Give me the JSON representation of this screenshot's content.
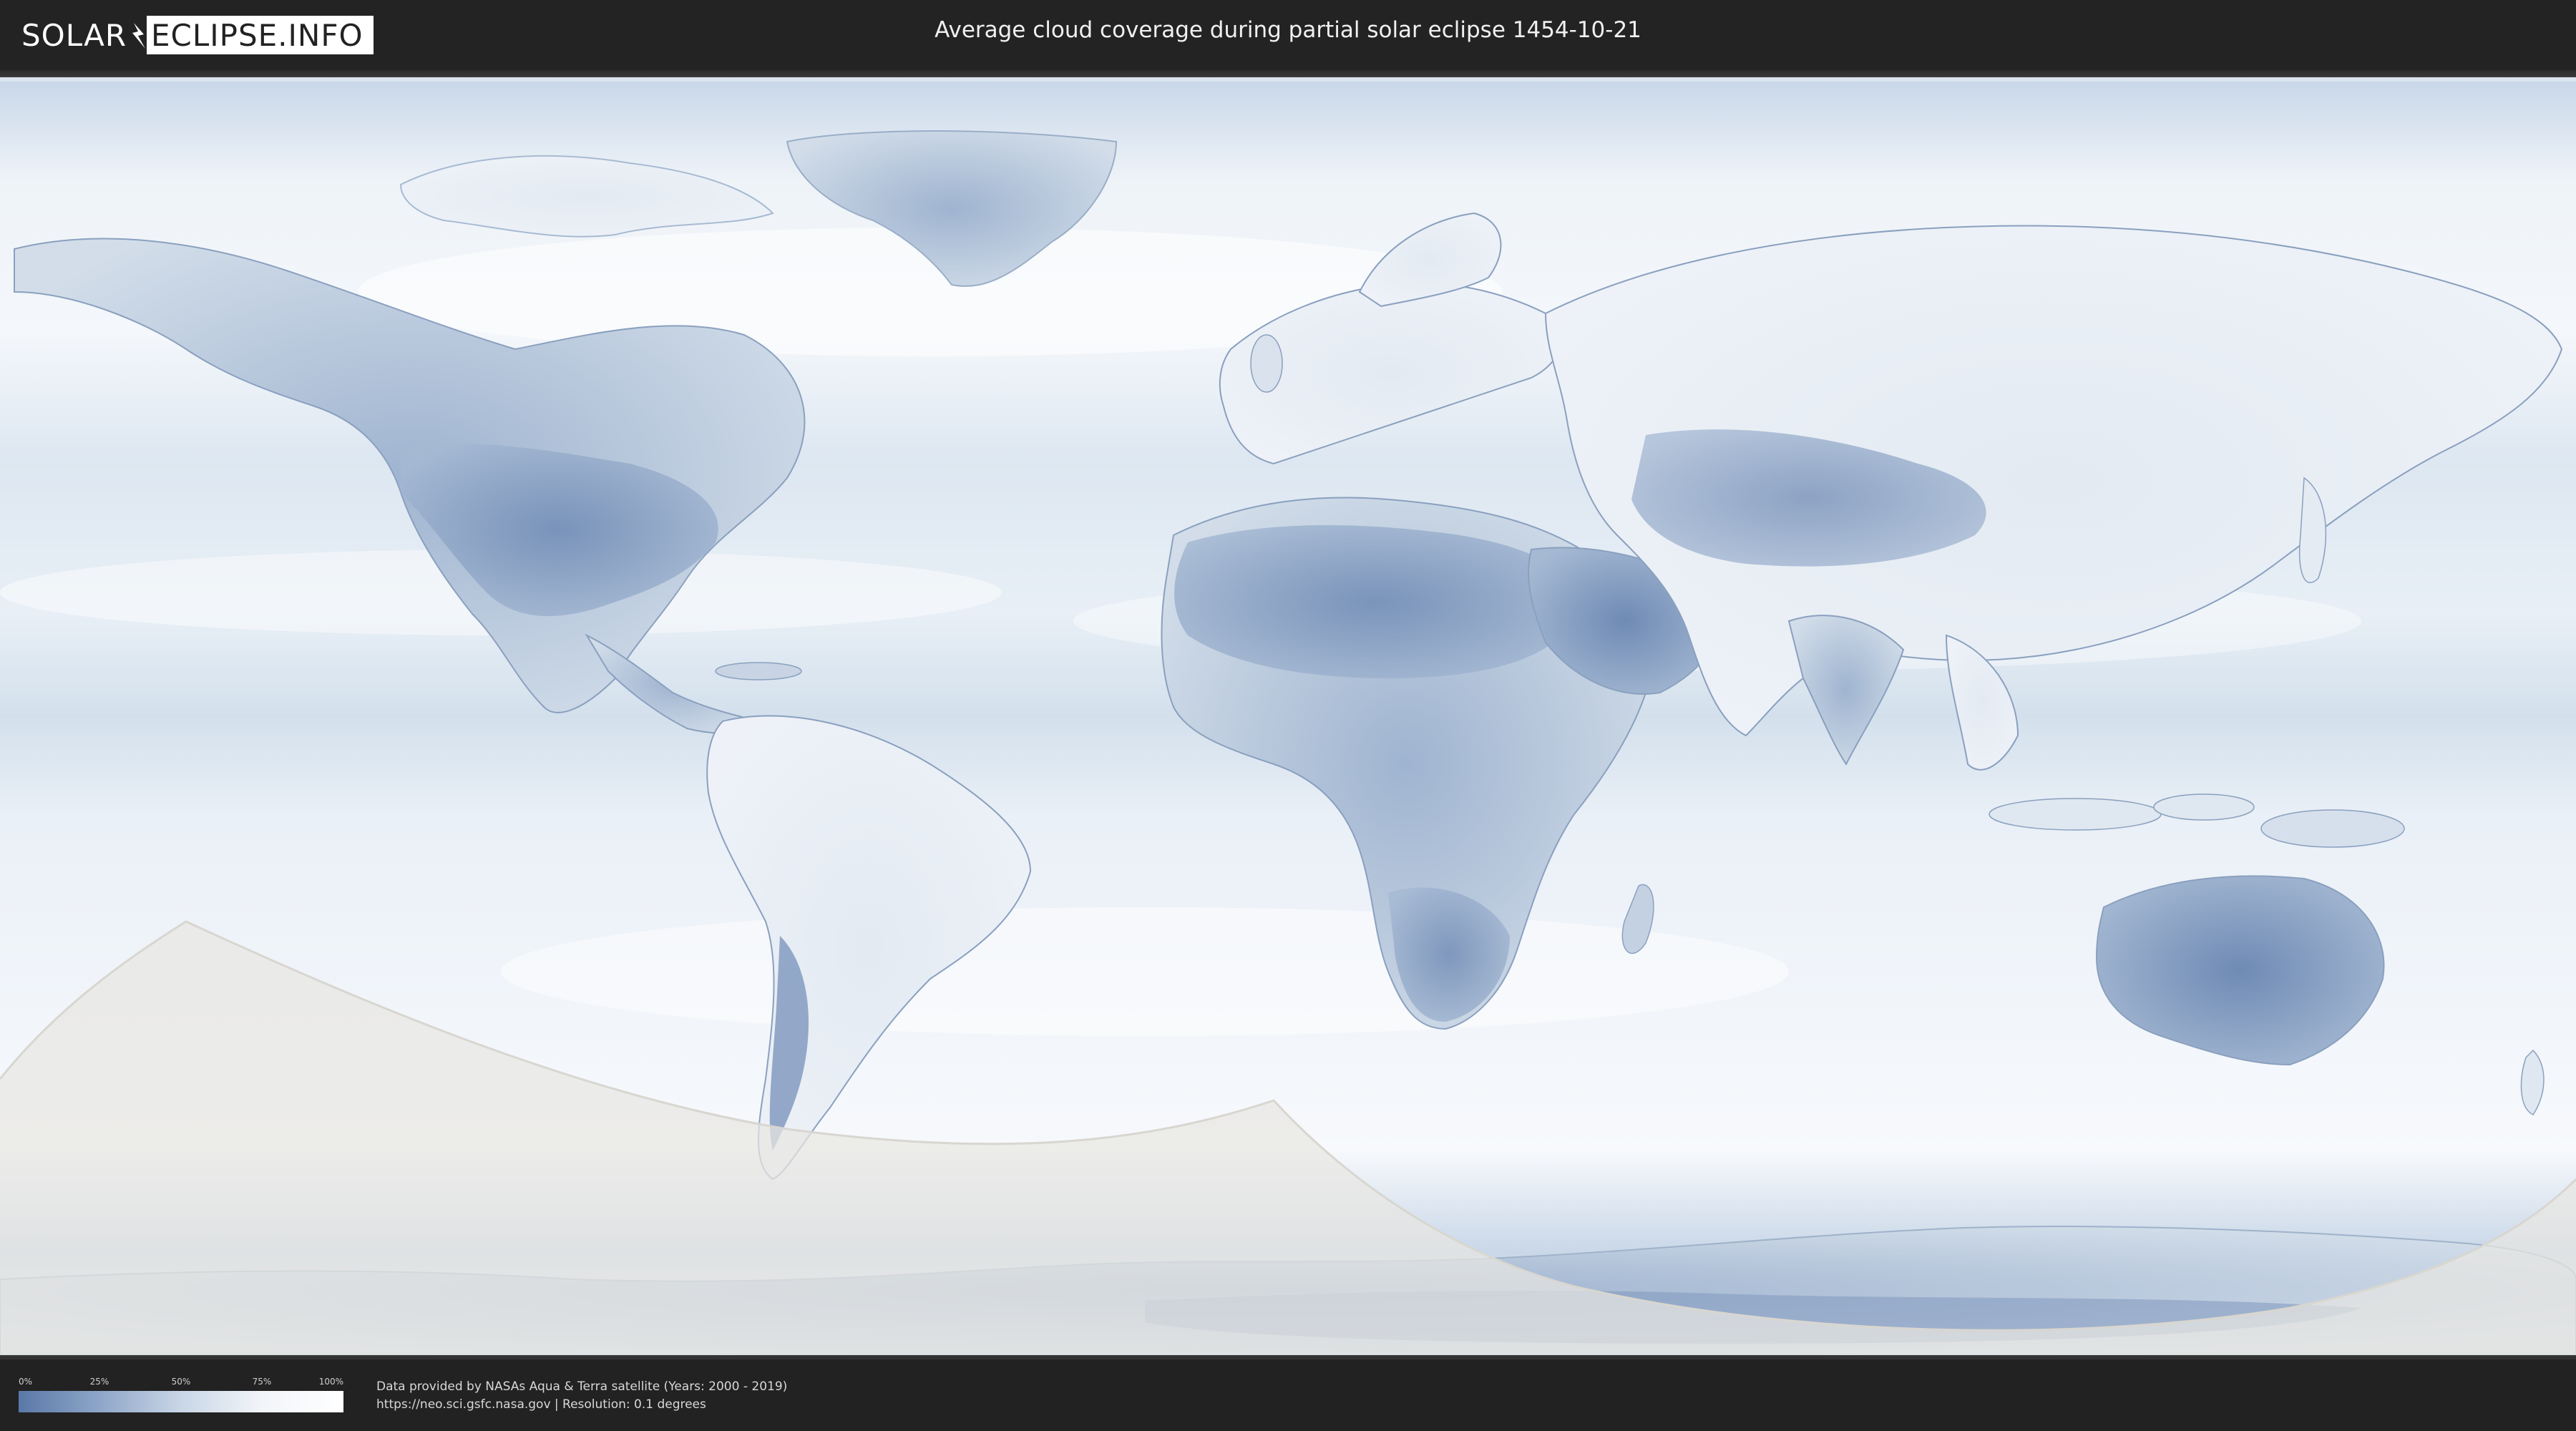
{
  "header": {
    "logo_left": "SOLAR",
    "logo_right": "ECLIPSE.INFO",
    "title": "Average cloud coverage during partial solar eclipse 1454-10-21"
  },
  "map": {
    "eclipse_date": "1454-10-21",
    "projection": "equirectangular",
    "cloud_low_color": "#5a78a8",
    "cloud_high_color": "#ffffff",
    "eclipse_overlay_color": "#e6e4e0"
  },
  "legend": {
    "ticks": [
      "0%",
      "25%",
      "50%",
      "75%",
      "100%"
    ]
  },
  "footer": {
    "source_line1": "Data provided by NASAs Aqua & Terra satellite (Years: 2000 - 2019)",
    "source_line2": "https://neo.sci.gsfc.nasa.gov | Resolution: 0.1 degrees"
  }
}
